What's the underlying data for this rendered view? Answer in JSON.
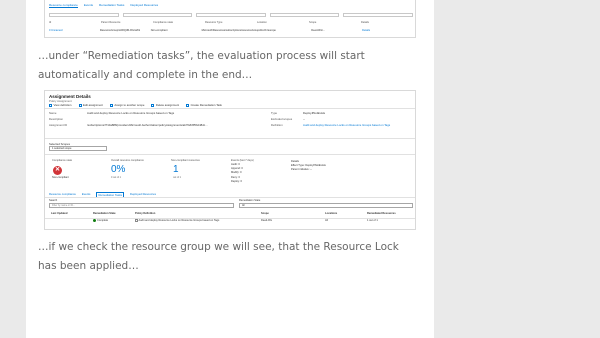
{
  "paragraphs": {
    "remediation": "…under “Remediation tasks”, the evaluation process will start automatically and complete in the end…",
    "resource_group": "…if we check the resource group we will see, that the Resource Lock has been applied…"
  },
  "top_screenshot": {
    "tabs": [
      "Resource compliance",
      "Events",
      "Remediation Tasks",
      "Deployed Resources"
    ],
    "columns": [
      "Id",
      "Parent Resource",
      "Compliance state",
      "Resource Type",
      "Location",
      "Scope",
      "Details"
    ],
    "row": [
      "0 Unnamed",
      "ResourceGroup/HJRQ3R-RG/HAS",
      "Non-compliant",
      "Microsoft/Resources/subscriptions/resourceGroups",
      "North Europe",
      "Deed-RG/...",
      "Details"
    ]
  },
  "assignment": {
    "title": "Assignment Details",
    "subtitle": "Policy Assignment",
    "toolbar": [
      "View definition",
      "Edit assignment",
      "Assign to another scope",
      "Delete assignment",
      "Create Remediation Task"
    ],
    "fields_left": [
      {
        "key": "Name",
        "value": "Audit and deploy Resource Locks on Resource Groups based on Tags"
      },
      {
        "key": "Description",
        "value": ""
      },
      {
        "key": "Assignment ID",
        "value": "/subscriptions/7f10a888/providers/Microsoft.Authorization/policyAssignments/ab762b8f5b248dc..."
      }
    ],
    "fields_right": [
      {
        "key": "Type",
        "value": "DeployIfNotExists"
      },
      {
        "key": "Excluded scopes",
        "value": "--"
      },
      {
        "key": "Definition",
        "value": "Audit and deploy Resource Locks on Resource Groups based on Tags"
      }
    ],
    "scope_label": "Selected Scopes",
    "scope_value": "1 selected scope",
    "compliance": {
      "state_label": "Compliance state",
      "state": "Non-compliant",
      "overall_label": "Overall resource compliance",
      "overall_value": "0%",
      "overall_sub": "0 out of 1",
      "noncompliant_label": "Non-compliant resources",
      "noncompliant_value": "1",
      "noncompliant_sub": "out of 1",
      "events_label": "Events (last 7 days)",
      "events": [
        "Audit: 0",
        "Append: 0",
        "Modify: 0",
        "Deny: 0",
        "Deploy: 0"
      ],
      "details_label": "Details",
      "details": [
        "Effect Type: DeployIfNotExists",
        "Parent initiative: --"
      ]
    },
    "tabs": [
      "Resource compliance",
      "Events",
      "Remediation Tasks",
      "Deployed Resources"
    ],
    "active_tab": "Remediation Tasks",
    "search_label": "Search",
    "search_placeholder": "Filter by name or ID...",
    "state_label": "Remediation State",
    "state_value": "All",
    "table_headers": [
      "Last Updated",
      "Remediation State",
      "Policy Definition",
      "Scope",
      "Locations",
      "Remediated Resources"
    ],
    "table_row": [
      "",
      "Complete",
      "Audit and deploy Resource Locks on Resource Groups based on Tags",
      "Deed-RG",
      "All",
      "1 out of 1"
    ]
  }
}
